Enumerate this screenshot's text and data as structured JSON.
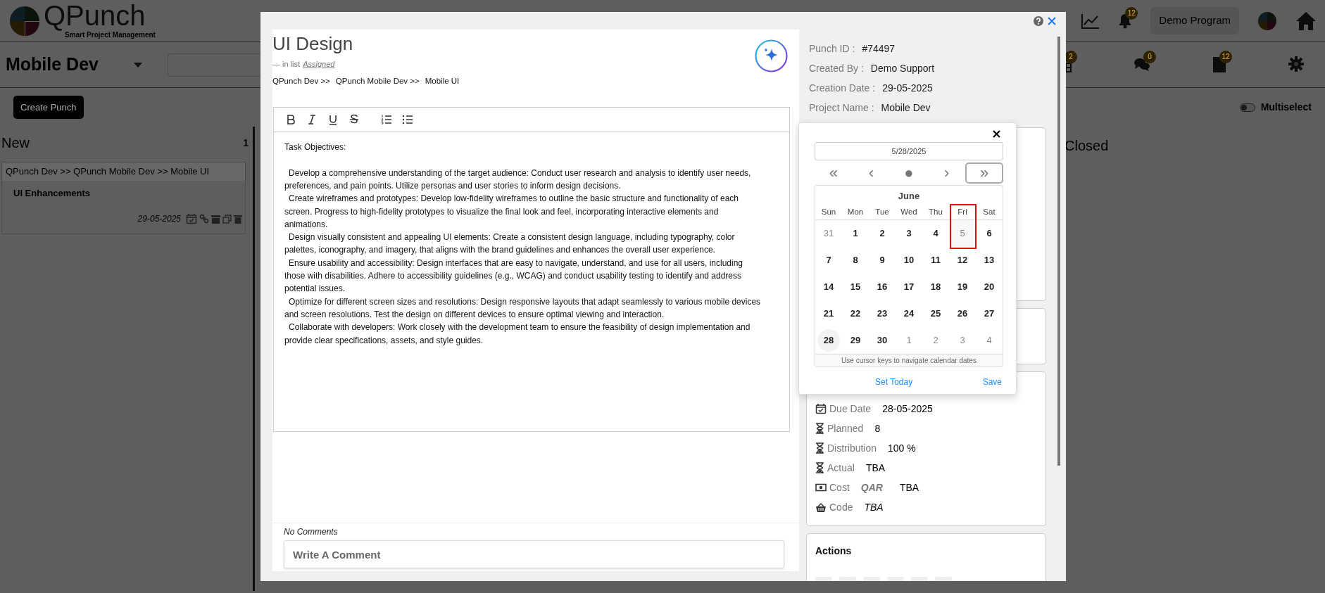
{
  "header": {
    "logo_title": "QPunch",
    "logo_subtitle": "Smart Project Management",
    "program_button": "Demo Program",
    "notification_badge": "12"
  },
  "toolbar": {
    "project": "Mobile Dev",
    "badges": [
      {
        "kind": "calendar",
        "count": "2"
      },
      {
        "kind": "chat",
        "count": "0"
      },
      {
        "kind": "document",
        "count": "12"
      }
    ],
    "create_button": "Create Punch",
    "multiselect": {
      "label": "Multiselect",
      "on": false
    }
  },
  "columns": [
    {
      "title": "New",
      "count": "1",
      "cards": [
        {
          "path": "QPunch Dev >>  QPunch Mobile Dev >>  Mobile UI",
          "title": "UI Enhancements",
          "date": "29-05-2025"
        }
      ]
    },
    {
      "title": "Closed"
    }
  ],
  "modal": {
    "title": "UI Design",
    "list_prefix": "—  in list",
    "list_name": "Assigned",
    "breadcrumb": [
      "QPunch Dev >>",
      "QPunch Mobile Dev >>",
      "Mobile UI"
    ],
    "editor": {
      "toolbar": [
        {
          "kind": "bold"
        },
        {
          "kind": "italic"
        },
        {
          "kind": "underline"
        },
        {
          "kind": "strike"
        },
        {
          "kind": "ordered-list"
        },
        {
          "kind": "bullet-list"
        }
      ],
      "heading": "Task Objectives:",
      "paragraphs": [
        "Develop a comprehensive understanding of the target audience: Conduct user research and analysis to identify user needs, preferences, and pain points. Utilize personas and user stories to inform design decisions.",
        "Create wireframes and prototypes: Develop low-fidelity wireframes to outline the basic structure and functionality of each screen. Progress to high-fidelity prototypes to visualize the final look and feel, incorporating interactive elements and animations.",
        "Design visually consistent and appealing UI elements: Create a consistent design language, including typography, color palettes, iconography, and imagery, that aligns with the brand guidelines and enhances the overall user experience.",
        "Ensure usability and accessibility: Design interfaces that are easy to navigate, understand, and use for all users, including those with disabilities. Adhere to accessibility guidelines (e.g., WCAG) and conduct usability testing to identify and address potential issues.",
        "Optimize for different screen sizes and resolutions: Design responsive layouts that adapt seamlessly to various mobile devices and screen resolutions. Test the design on different devices to ensure optimal viewing and interaction.",
        "Collaborate with developers: Work closely with the development team to ensure the feasibility of design implementation and provide clear specifications, assets, and style guides."
      ]
    },
    "comments": {
      "empty_label": "No Comments",
      "placeholder": "Write A Comment"
    },
    "details": [
      {
        "label": "Punch ID :",
        "value": "#74497"
      },
      {
        "label": "Created By :",
        "value": "Demo Support"
      },
      {
        "label": "Creation Date :",
        "value": "29-05-2025"
      },
      {
        "label": "Project Name :",
        "value": "Mobile Dev"
      }
    ],
    "properties": [
      {
        "kind": "calendar",
        "label": "Due Date",
        "value": "28-05-2025",
        "italic": false
      },
      {
        "kind": "hourglass",
        "label": "Planned",
        "value": "8",
        "italic": false
      },
      {
        "kind": "hourglass",
        "label": "Distribution",
        "value": "100 %",
        "italic": false
      },
      {
        "kind": "hourglass",
        "label": "Actual",
        "value": "TBA",
        "italic": false
      },
      {
        "kind": "money",
        "label": "Cost",
        "unit": "QAR",
        "value": "TBA",
        "italic": false
      },
      {
        "kind": "basket",
        "label": "Code",
        "value": "TBA",
        "italic": true
      }
    ],
    "actions": {
      "title": "Actions"
    }
  },
  "datepicker": {
    "value": "5/28/2025",
    "nav": [
      {
        "glyph": "«",
        "focused": false
      },
      {
        "glyph": "‹",
        "focused": false
      },
      {
        "glyph": "●",
        "focused": false
      },
      {
        "glyph": "›",
        "focused": false
      },
      {
        "glyph": "»",
        "focused": true
      }
    ],
    "month": "June",
    "weekdays": [
      {
        "label": "Sun",
        "marked": false
      },
      {
        "label": "Mon",
        "marked": false
      },
      {
        "label": "Tue",
        "marked": false
      },
      {
        "label": "Wed",
        "marked": false
      },
      {
        "label": "Thu",
        "marked": false
      },
      {
        "label": "Fri",
        "marked": true
      },
      {
        "label": "Sat",
        "marked": false
      }
    ],
    "weeks": [
      [
        {
          "day": "31",
          "muted": true,
          "selected": false,
          "marked": false
        },
        {
          "day": "1",
          "muted": false,
          "selected": false,
          "marked": false
        },
        {
          "day": "2",
          "muted": false,
          "selected": false,
          "marked": false
        },
        {
          "day": "3",
          "muted": false,
          "selected": false,
          "marked": false
        },
        {
          "day": "4",
          "muted": false,
          "selected": false,
          "marked": false
        },
        {
          "day": "5",
          "muted": true,
          "selected": false,
          "marked": true
        },
        {
          "day": "6",
          "muted": false,
          "selected": false,
          "marked": false
        }
      ],
      [
        {
          "day": "7",
          "muted": false,
          "selected": false,
          "marked": false
        },
        {
          "day": "8",
          "muted": false,
          "selected": false,
          "marked": false
        },
        {
          "day": "9",
          "muted": false,
          "selected": false,
          "marked": false
        },
        {
          "day": "10",
          "muted": false,
          "selected": false,
          "marked": false
        },
        {
          "day": "11",
          "muted": false,
          "selected": false,
          "marked": false
        },
        {
          "day": "12",
          "muted": false,
          "selected": false,
          "marked": false
        },
        {
          "day": "13",
          "muted": false,
          "selected": false,
          "marked": false
        }
      ],
      [
        {
          "day": "14",
          "muted": false,
          "selected": false,
          "marked": false
        },
        {
          "day": "15",
          "muted": false,
          "selected": false,
          "marked": false
        },
        {
          "day": "16",
          "muted": false,
          "selected": false,
          "marked": false
        },
        {
          "day": "17",
          "muted": false,
          "selected": false,
          "marked": false
        },
        {
          "day": "18",
          "muted": false,
          "selected": false,
          "marked": false
        },
        {
          "day": "19",
          "muted": false,
          "selected": false,
          "marked": false
        },
        {
          "day": "20",
          "muted": false,
          "selected": false,
          "marked": false
        }
      ],
      [
        {
          "day": "21",
          "muted": false,
          "selected": false,
          "marked": false
        },
        {
          "day": "22",
          "muted": false,
          "selected": false,
          "marked": false
        },
        {
          "day": "23",
          "muted": false,
          "selected": false,
          "marked": false
        },
        {
          "day": "24",
          "muted": false,
          "selected": false,
          "marked": false
        },
        {
          "day": "25",
          "muted": false,
          "selected": false,
          "marked": false
        },
        {
          "day": "26",
          "muted": false,
          "selected": false,
          "marked": false
        },
        {
          "day": "27",
          "muted": false,
          "selected": false,
          "marked": false
        }
      ],
      [
        {
          "day": "28",
          "muted": false,
          "selected": true,
          "marked": false
        },
        {
          "day": "29",
          "muted": false,
          "selected": false,
          "marked": false
        },
        {
          "day": "30",
          "muted": false,
          "selected": false,
          "marked": false
        },
        {
          "day": "1",
          "muted": true,
          "selected": false,
          "marked": false
        },
        {
          "day": "2",
          "muted": true,
          "selected": false,
          "marked": false
        },
        {
          "day": "3",
          "muted": true,
          "selected": false,
          "marked": false
        },
        {
          "day": "4",
          "muted": true,
          "selected": false,
          "marked": false
        }
      ]
    ],
    "hint": "Use cursor keys to navigate calendar dates",
    "today_button": "Set Today",
    "save_button": "Save"
  }
}
